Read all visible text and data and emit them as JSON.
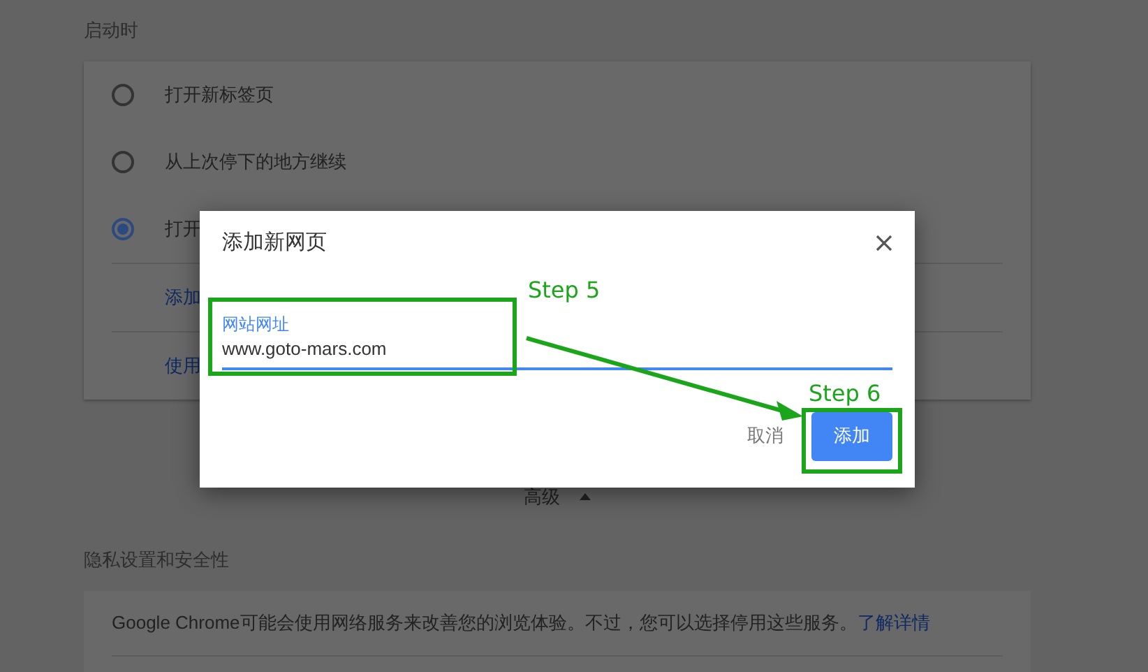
{
  "startup": {
    "title": "启动时",
    "options": [
      {
        "label": "打开新标签页",
        "selected": false
      },
      {
        "label": "从上次停下的地方继续",
        "selected": false
      },
      {
        "label": "打开",
        "selected": true
      }
    ],
    "links": [
      "添加",
      "使用"
    ]
  },
  "advanced": {
    "label": "高级",
    "expanded": true
  },
  "privacy": {
    "title": "隐私设置和安全性",
    "text": "Google Chrome可能会使用网络服务来改善您的浏览体验。不过，您可以选择停用这些服务。",
    "link": "了解详情"
  },
  "dialog": {
    "title": "添加新网页",
    "field": {
      "label": "网站网址",
      "value": "www.goto-mars.com"
    },
    "buttons": [
      {
        "label": "取消",
        "kind": "text"
      },
      {
        "label": "添加",
        "kind": "primary"
      }
    ]
  },
  "annotations": [
    {
      "label": "Step 5"
    },
    {
      "label": "Step 6"
    }
  ]
}
